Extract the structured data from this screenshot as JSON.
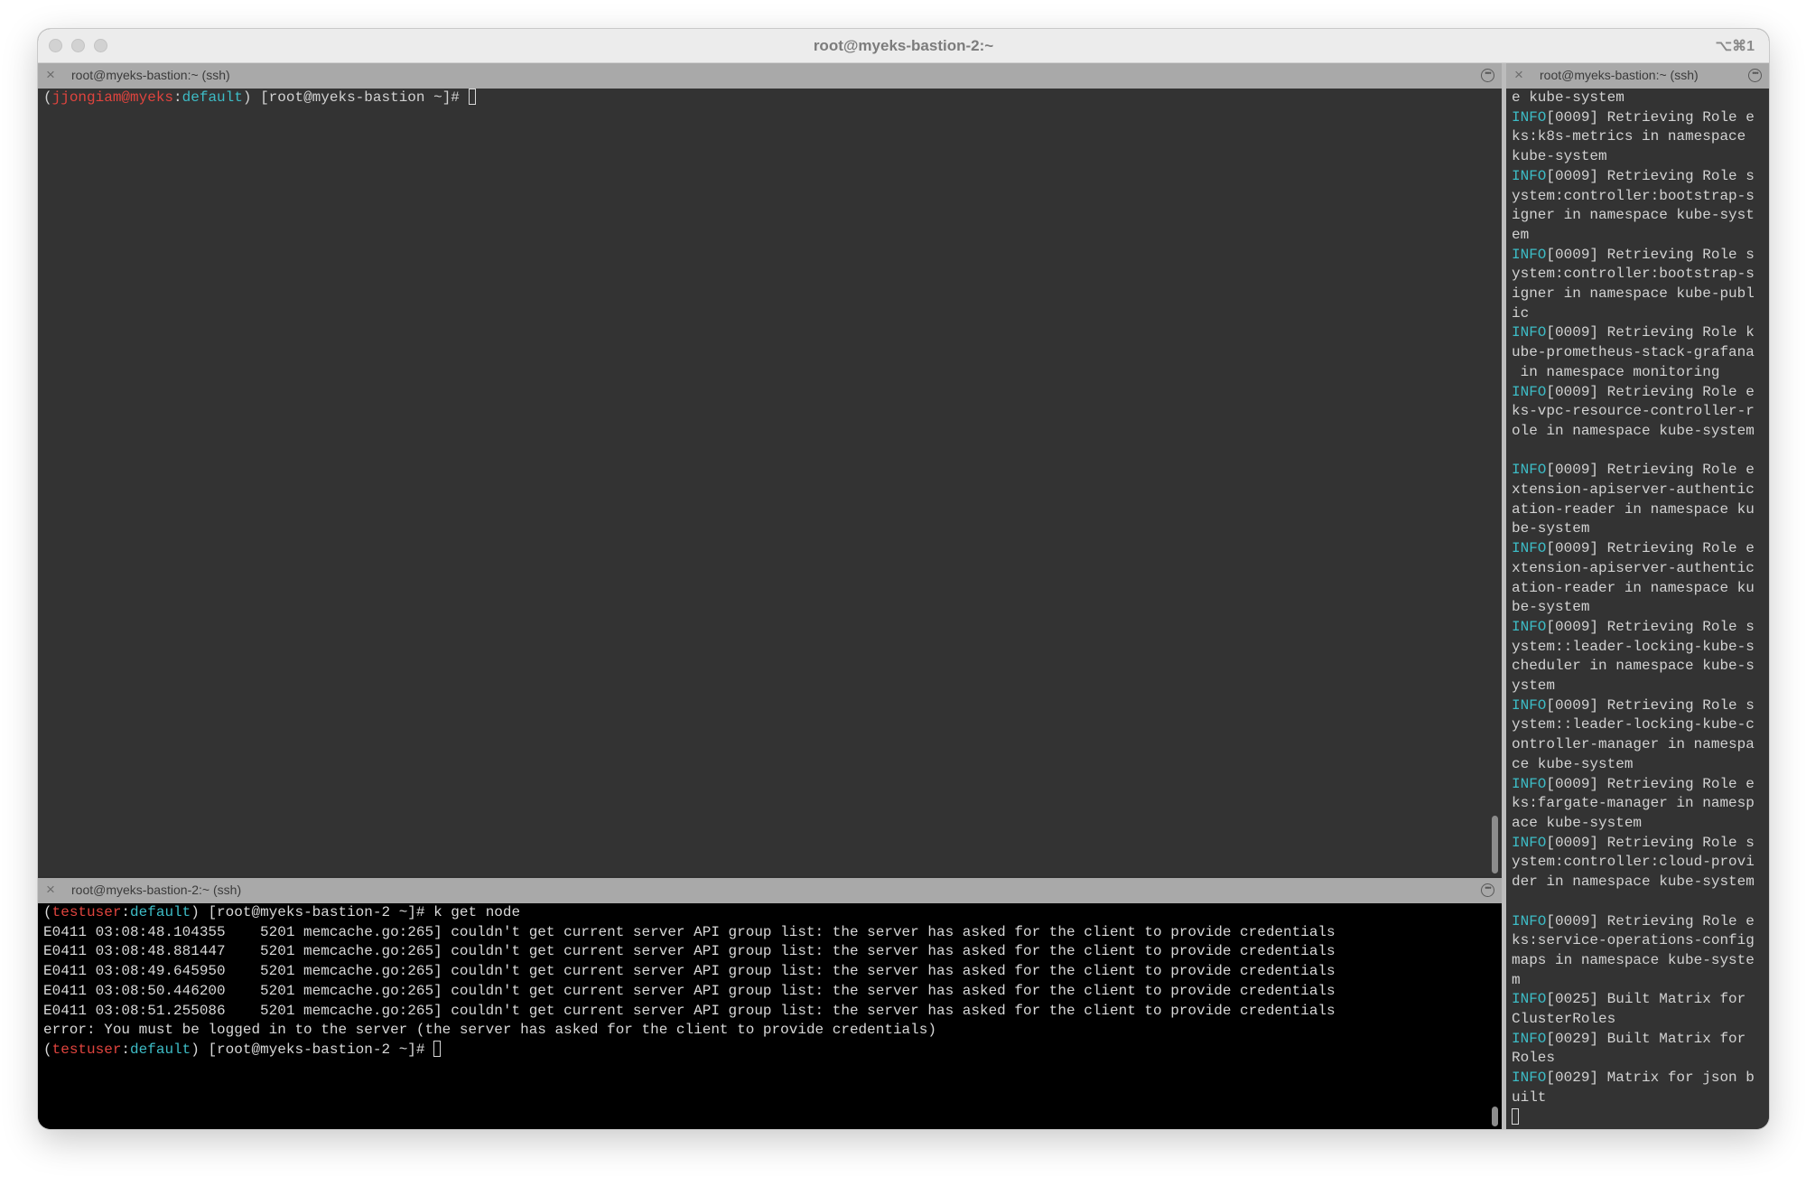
{
  "window": {
    "title": "root@myeks-bastion-2:~",
    "shortcut": "⌥⌘1"
  },
  "pane_top_left": {
    "tab_title": "root@myeks-bastion:~ (ssh)",
    "prompt": {
      "open": "(",
      "user": "jjongiam@myeks",
      "sep": ":",
      "ns": "default",
      "rest": ") [root@myeks-bastion ~]# "
    }
  },
  "pane_bottom_left": {
    "tab_title": "root@myeks-bastion-2:~ (ssh)",
    "cmd_prompt": {
      "open": "(",
      "user": "testuser",
      "sep": ":",
      "ns": "default",
      "rest": ") [root@myeks-bastion-2 ~]# ",
      "command": "k get node"
    },
    "output": [
      "E0411 03:08:48.104355    5201 memcache.go:265] couldn't get current server API group list: the server has asked for the client to provide credentials",
      "E0411 03:08:48.881447    5201 memcache.go:265] couldn't get current server API group list: the server has asked for the client to provide credentials",
      "E0411 03:08:49.645950    5201 memcache.go:265] couldn't get current server API group list: the server has asked for the client to provide credentials",
      "E0411 03:08:50.446200    5201 memcache.go:265] couldn't get current server API group list: the server has asked for the client to provide credentials",
      "E0411 03:08:51.255086    5201 memcache.go:265] couldn't get current server API group list: the server has asked for the client to provide credentials",
      "error: You must be logged in to the server (the server has asked for the client to provide credentials)"
    ],
    "final_prompt": {
      "open": "(",
      "user": "testuser",
      "sep": ":",
      "ns": "default",
      "rest": ") [root@myeks-bastion-2 ~]# "
    }
  },
  "pane_right": {
    "tab_title": "root@myeks-bastion:~ (ssh)",
    "info_tag": "INFO",
    "lines": [
      {
        "info": false,
        "text": "e kube-system"
      },
      {
        "info": true,
        "text": "[0009] Retrieving Role e"
      },
      {
        "info": false,
        "text": "ks:k8s-metrics in namespace"
      },
      {
        "info": false,
        "text": "kube-system"
      },
      {
        "info": true,
        "text": "[0009] Retrieving Role s"
      },
      {
        "info": false,
        "text": "ystem:controller:bootstrap-s"
      },
      {
        "info": false,
        "text": "igner in namespace kube-syst"
      },
      {
        "info": false,
        "text": "em"
      },
      {
        "info": true,
        "text": "[0009] Retrieving Role s"
      },
      {
        "info": false,
        "text": "ystem:controller:bootstrap-s"
      },
      {
        "info": false,
        "text": "igner in namespace kube-publ"
      },
      {
        "info": false,
        "text": "ic"
      },
      {
        "info": true,
        "text": "[0009] Retrieving Role k"
      },
      {
        "info": false,
        "text": "ube-prometheus-stack-grafana"
      },
      {
        "info": false,
        "text": " in namespace monitoring"
      },
      {
        "info": true,
        "text": "[0009] Retrieving Role e"
      },
      {
        "info": false,
        "text": "ks-vpc-resource-controller-r"
      },
      {
        "info": false,
        "text": "ole in namespace kube-system"
      },
      {
        "info": false,
        "text": ""
      },
      {
        "info": true,
        "text": "[0009] Retrieving Role e"
      },
      {
        "info": false,
        "text": "xtension-apiserver-authentic"
      },
      {
        "info": false,
        "text": "ation-reader in namespace ku"
      },
      {
        "info": false,
        "text": "be-system"
      },
      {
        "info": true,
        "text": "[0009] Retrieving Role e"
      },
      {
        "info": false,
        "text": "xtension-apiserver-authentic"
      },
      {
        "info": false,
        "text": "ation-reader in namespace ku"
      },
      {
        "info": false,
        "text": "be-system"
      },
      {
        "info": true,
        "text": "[0009] Retrieving Role s"
      },
      {
        "info": false,
        "text": "ystem::leader-locking-kube-s"
      },
      {
        "info": false,
        "text": "cheduler in namespace kube-s"
      },
      {
        "info": false,
        "text": "ystem"
      },
      {
        "info": true,
        "text": "[0009] Retrieving Role s"
      },
      {
        "info": false,
        "text": "ystem::leader-locking-kube-c"
      },
      {
        "info": false,
        "text": "ontroller-manager in namespa"
      },
      {
        "info": false,
        "text": "ce kube-system"
      },
      {
        "info": true,
        "text": "[0009] Retrieving Role e"
      },
      {
        "info": false,
        "text": "ks:fargate-manager in namesp"
      },
      {
        "info": false,
        "text": "ace kube-system"
      },
      {
        "info": true,
        "text": "[0009] Retrieving Role s"
      },
      {
        "info": false,
        "text": "ystem:controller:cloud-provi"
      },
      {
        "info": false,
        "text": "der in namespace kube-system"
      },
      {
        "info": false,
        "text": ""
      },
      {
        "info": true,
        "text": "[0009] Retrieving Role e"
      },
      {
        "info": false,
        "text": "ks:service-operations-config"
      },
      {
        "info": false,
        "text": "maps in namespace kube-syste"
      },
      {
        "info": false,
        "text": "m"
      },
      {
        "info": true,
        "text": "[0025] Built Matrix for"
      },
      {
        "info": false,
        "text": "ClusterRoles"
      },
      {
        "info": true,
        "text": "[0029] Built Matrix for"
      },
      {
        "info": false,
        "text": "Roles"
      },
      {
        "info": true,
        "text": "[0029] Matrix for json b"
      },
      {
        "info": false,
        "text": "uilt"
      }
    ]
  },
  "colors": {
    "prompt_user": "#e0443e",
    "prompt_ns": "#3dbcc6",
    "top_bg": "#333333",
    "bottom_bg": "#000000"
  }
}
